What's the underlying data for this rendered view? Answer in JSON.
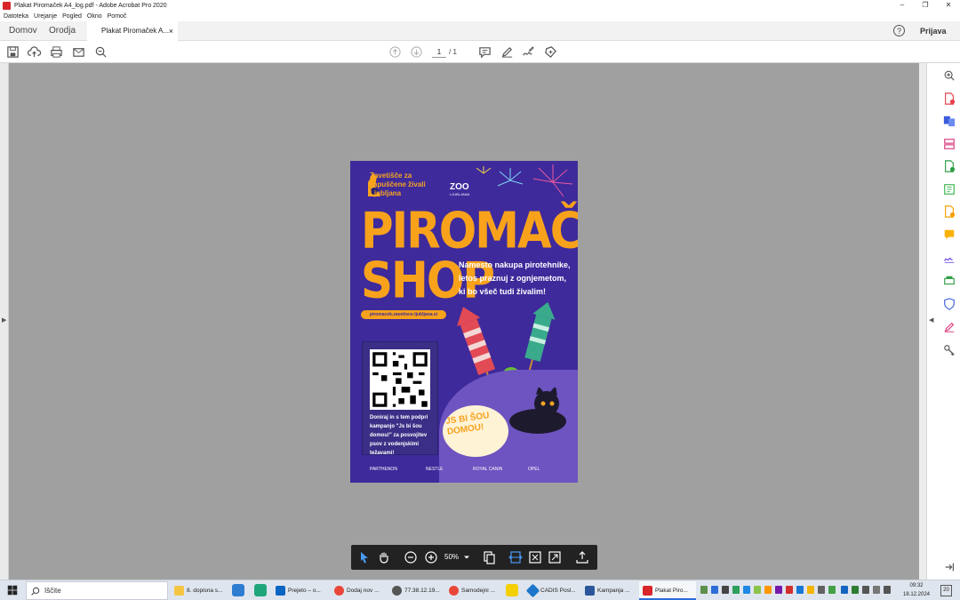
{
  "window": {
    "title": "Plakat Piromaček A4_log.pdf - Adobe Acrobat Pro 2020",
    "controls": [
      "–",
      "❐",
      "✕"
    ]
  },
  "menu": [
    "Datoteka",
    "Urejanje",
    "Pogled",
    "Okno",
    "Pomoč"
  ],
  "tabs": {
    "home": "Domov",
    "tools": "Orodja",
    "document": "Plakat Piromaček A...",
    "close": "×",
    "help": "?",
    "signin": "Prijava"
  },
  "toolbar": {
    "page_current": "1",
    "page_total": "/ 1"
  },
  "poster": {
    "org": "Zavetišče za zapuščene živali Ljubljana",
    "zoo": "ZOO",
    "zoo_sub": "LJUBLJANA",
    "headline1": "PIROMAČEK",
    "headline2": "SHOP",
    "tagline": "Namesto nakupa pirotehnike, letos praznuj z ognjemetom, ki bo všeč tudi živalim!",
    "url": "piromacek.zavetisce-ljubljana.si",
    "donate": "Doniraj in s tem podpri kampanjo \"Js bi šou domou!\" za posvojitev psov z vodenjskimi težavami!",
    "bubble": "JS BI ŠOU DOMOU!",
    "sponsors": [
      "PARTHENON",
      "NESTLE",
      "ROYAL CANIN",
      "OPEL"
    ]
  },
  "floatbar": {
    "zoom": "50%"
  },
  "taskbar": {
    "search": "Iščite",
    "items": [
      "8. dopisna s...",
      "Prejeto – o...",
      "Dodaj nov ...",
      "77.38.12.19...",
      "Samodejni ...",
      "CADIS Posl...",
      "Kampanja ...",
      "Plakat Piro..."
    ],
    "time": "09:32",
    "date": "18.12.2024",
    "notifications": "20"
  }
}
